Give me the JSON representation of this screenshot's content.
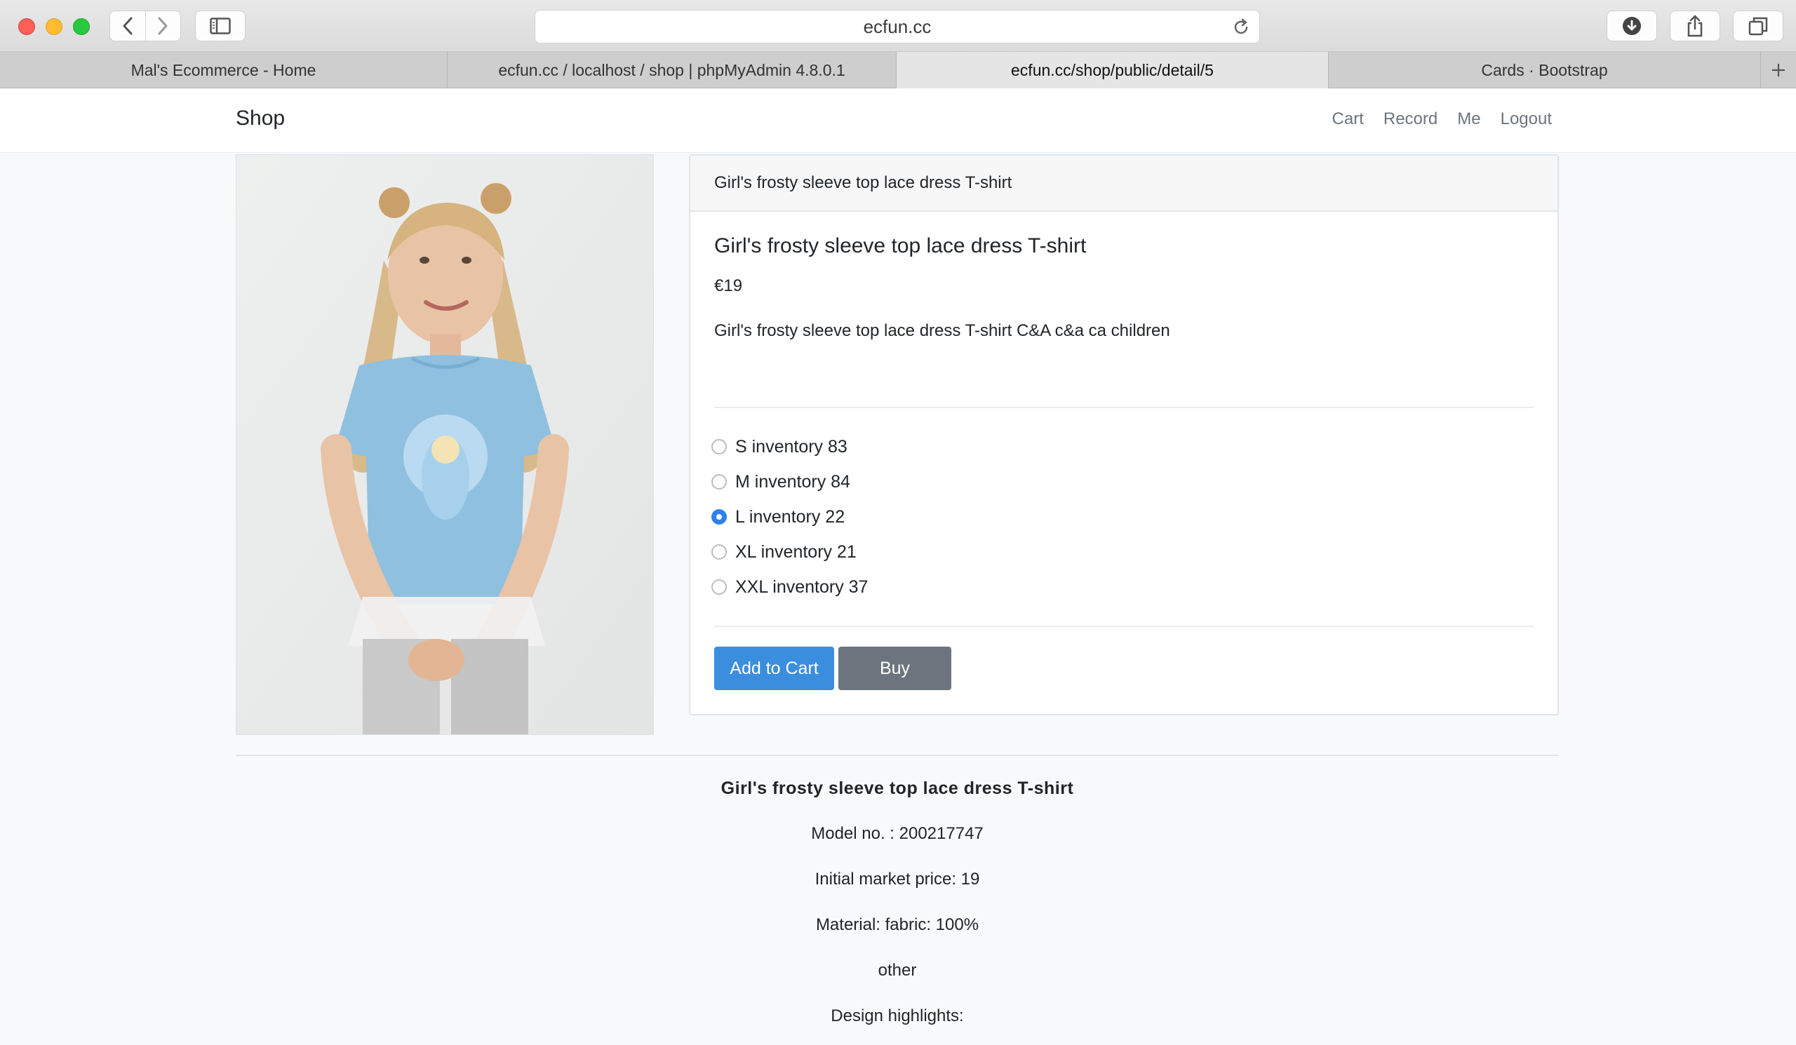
{
  "browser": {
    "url": "ecfun.cc",
    "tabs": [
      {
        "label": "Mal's Ecommerce - Home",
        "active": false
      },
      {
        "label": "ecfun.cc / localhost / shop | phpMyAdmin 4.8.0.1",
        "active": false
      },
      {
        "label": "ecfun.cc/shop/public/detail/5",
        "active": true
      },
      {
        "label": "Cards · Bootstrap",
        "active": false
      }
    ]
  },
  "navbar": {
    "brand": "Shop",
    "links": [
      "Cart",
      "Record",
      "Me",
      "Logout"
    ]
  },
  "product": {
    "header": "Girl's frosty sleeve top lace dress T-shirt",
    "title": "Girl's frosty sleeve top lace dress T-shirt",
    "price": "€19",
    "description": "Girl's frosty sleeve top lace dress T-shirt C&A c&a ca children",
    "options": [
      {
        "label": "S inventory 83",
        "checked": false
      },
      {
        "label": "M inventory 84",
        "checked": false
      },
      {
        "label": "L inventory 22",
        "checked": true
      },
      {
        "label": "XL inventory 21",
        "checked": false
      },
      {
        "label": "XXL inventory 37",
        "checked": false
      }
    ],
    "add_to_cart_label": "Add to Cart",
    "buy_label": "Buy"
  },
  "details": {
    "heading": "Girl's frosty sleeve top lace dress T-shirt",
    "lines": [
      "Model no. : 200217747",
      "Initial market price: 19",
      "Material: fabric: 100%",
      "other",
      "Design highlights:"
    ]
  },
  "colors": {
    "primary": "#3b8ede",
    "secondary": "#6c757d",
    "radio_checked": "#2f80ed"
  }
}
